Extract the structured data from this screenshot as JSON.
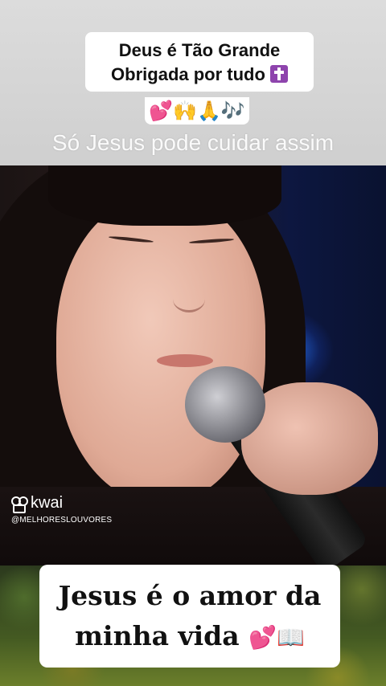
{
  "header": {
    "title_line1": "Deus é Tão Grande",
    "title_line2": "Obrigada por tudo",
    "title_cross_icon": "latin-cross-icon",
    "emoji_line": "💕🙌🙏🎶",
    "subtitle": "Só Jesus pode cuidar assim"
  },
  "watermark": {
    "brand": "kwai",
    "handle": "@MELHORESLOUVORES"
  },
  "caption": {
    "line1": "Jesus é o amor da",
    "line2": "minha vida",
    "line2_emoji": "💕📖"
  },
  "colors": {
    "cross_badge": "#8e44ad",
    "top_band": "#d9d9d9",
    "card_bg": "#ffffff"
  }
}
